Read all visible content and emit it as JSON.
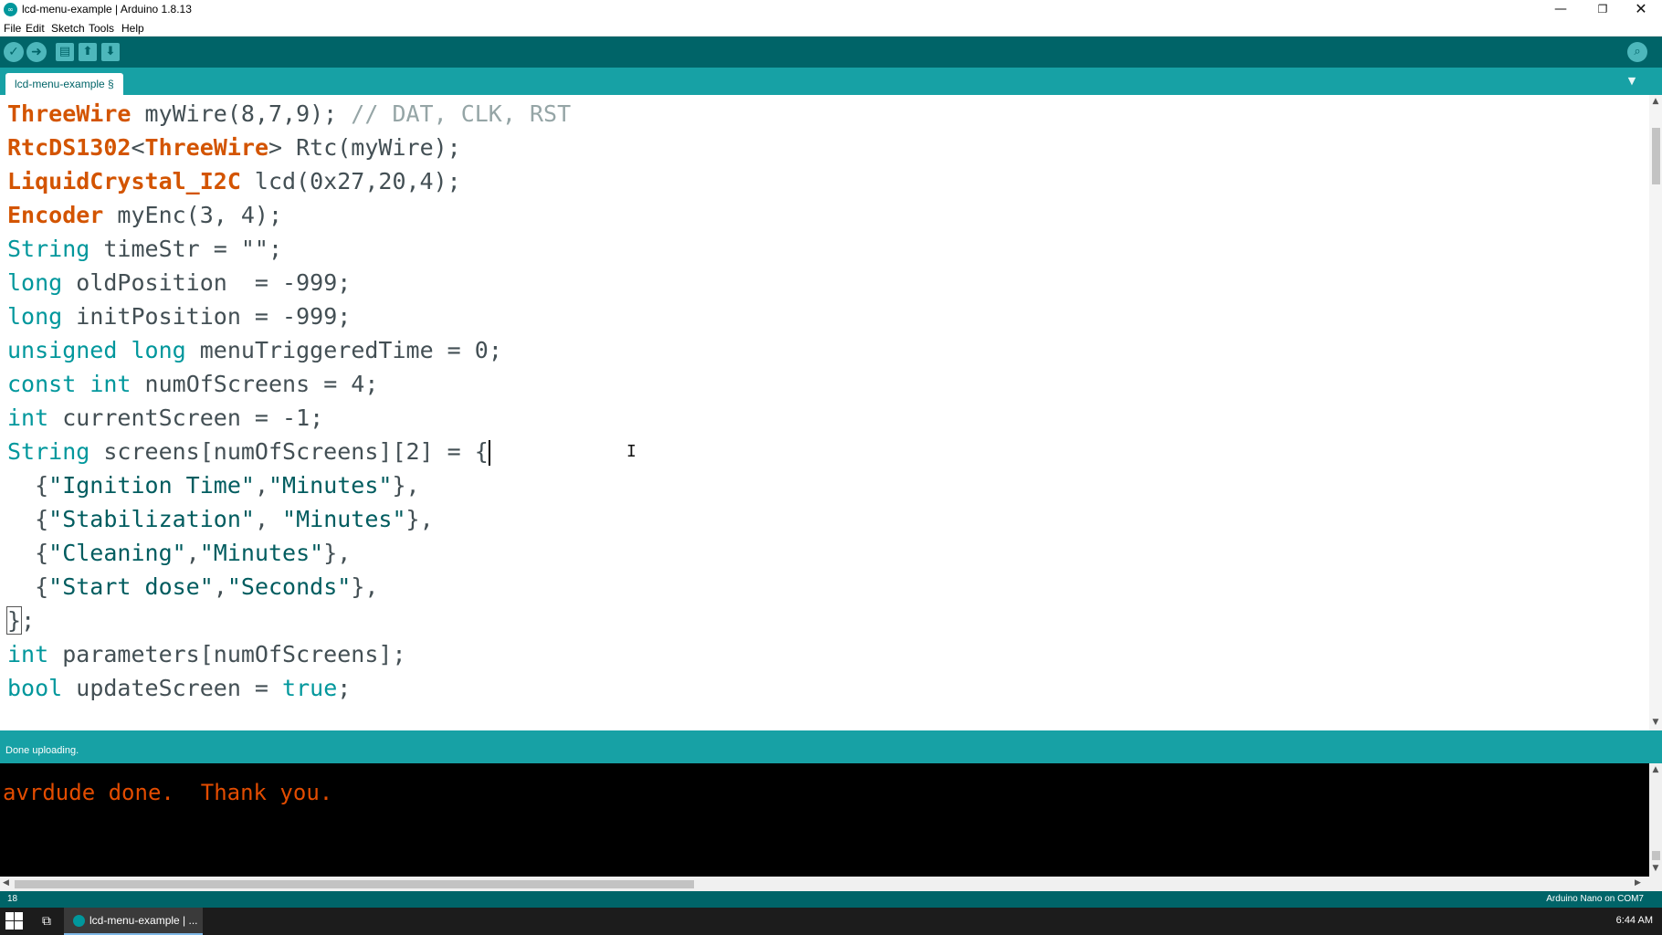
{
  "window": {
    "title": "lcd-menu-example | Arduino 1.8.13",
    "app_icon_text": "∞",
    "minimize": "—",
    "maximize": "❐",
    "close": "✕"
  },
  "menu": [
    "File",
    "Edit",
    "Sketch",
    "Tools",
    "Help"
  ],
  "toolbar": {
    "verify_icon": "✓",
    "upload_icon": "➜",
    "new_icon": "▤",
    "open_icon": "⬆",
    "save_icon": "⬇",
    "serial_monitor_icon": "⌕"
  },
  "tabs": {
    "active": "lcd-menu-example §",
    "menu_icon": "▼"
  },
  "code": {
    "l1": {
      "a": "ThreeWire",
      "b": " myWire(8,7,9); ",
      "c": "// DAT, CLK, RST"
    },
    "l2": {
      "a": "RtcDS1302",
      "b": "<",
      "c": "ThreeWire",
      "d": "> Rtc(myWire);"
    },
    "l3": {
      "a": "LiquidCrystal_I2C",
      "b": " lcd(0x27,20,4);"
    },
    "l4": {
      "a": "Encoder",
      "b": " myEnc(3, 4);"
    },
    "l5": {
      "a": "String",
      "b": " timeStr = \"\";"
    },
    "l6": {
      "a": "long",
      "b": " oldPosition  = -999;"
    },
    "l7": {
      "a": "long",
      "b": " initPosition = -999;"
    },
    "l8": {
      "a": "unsigned",
      "b": " ",
      "c": "long",
      "d": " menuTriggeredTime = 0;"
    },
    "l9": {
      "a": "const",
      "b": " ",
      "c": "int",
      "d": " numOfScreens = 4;"
    },
    "l10": {
      "a": "int",
      "b": " currentScreen = -1;"
    },
    "l11": {
      "a": "String",
      "b": " screens[numOfScreens][2] = {"
    },
    "l12": {
      "a": "  {",
      "b": "\"Ignition Time\"",
      "c": ",",
      "d": "\"Minutes\"",
      "e": "},"
    },
    "l13": {
      "a": "  {",
      "b": "\"Stabilization\"",
      "c": ", ",
      "d": "\"Minutes\"",
      "e": "},"
    },
    "l14": {
      "a": "  {",
      "b": "\"Cleaning\"",
      "c": ",",
      "d": "\"Minutes\"",
      "e": "},"
    },
    "l15": {
      "a": "  {",
      "b": "\"Start dose\"",
      "c": ",",
      "d": "\"Seconds\"",
      "e": "},"
    },
    "l16": {
      "a": "}",
      "b": ";"
    },
    "l17": {
      "a": "int",
      "b": " parameters[numOfScreens];"
    },
    "l18": {
      "a": "bool",
      "b": " updateScreen = ",
      "c": "true",
      "d": ";"
    }
  },
  "status": {
    "message": "Done uploading."
  },
  "console": {
    "output": "avrdude done.  Thank you."
  },
  "infobar": {
    "line": "18",
    "board": "Arduino Nano on COM7"
  },
  "taskbar": {
    "task_label": "lcd-menu-example | ...",
    "task_view_icon": "⧉",
    "clock": "6:44 AM"
  },
  "colors": {
    "toolbar": "#006468",
    "tabbar": "#17a1a5",
    "keyword_class": "#d35400",
    "keyword_type": "#00979c",
    "console_text": "#e34c00"
  }
}
